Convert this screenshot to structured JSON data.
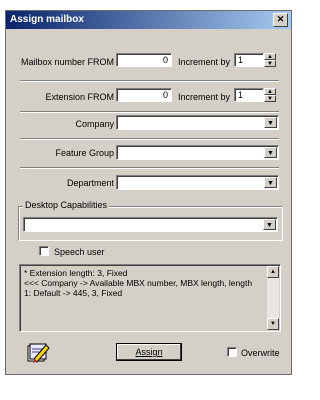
{
  "window": {
    "title": "Assign mailbox",
    "close_glyph": "✕"
  },
  "mailbox": {
    "label": "Mailbox number FROM",
    "value": "0",
    "increment_label": "Increment by",
    "increment_value": "1"
  },
  "extension": {
    "label": "Extension FROM",
    "value": "0",
    "increment_label": "Increment by",
    "increment_value": "1"
  },
  "company": {
    "label": "Company",
    "value": ""
  },
  "feature_group": {
    "label": "Feature Group",
    "value": ""
  },
  "department": {
    "label": "Department",
    "value": ""
  },
  "desktop": {
    "label": "Desktop Capabilities",
    "value": ""
  },
  "speech_user": {
    "label": "Speech user",
    "checked": false
  },
  "info": {
    "lines": [
      "* Extension length: 3, Fixed",
      "<<< Company -> Available MBX number, MBX length, length",
      "1: Default -> 445, 3, Fixed"
    ]
  },
  "assign_button": {
    "label": "Assign"
  },
  "overwrite": {
    "label": "Overwrite",
    "checked": false
  },
  "icons": {
    "app": "pencil-note-icon",
    "dropdown": "▼",
    "spin_up": "▲",
    "spin_down": "▼"
  }
}
